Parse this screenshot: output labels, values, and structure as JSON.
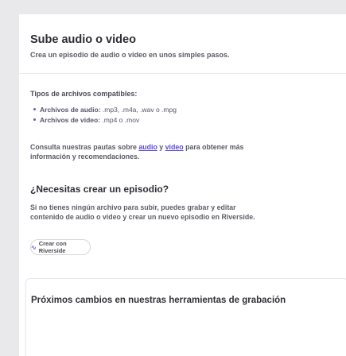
{
  "upload": {
    "title": "Sube audio o video",
    "subtitle": "Crea un episodio de audio o video en unos simples pasos.",
    "types_heading": "Tipos de archivos compatibles:",
    "types": [
      {
        "label": "Archivos de audio:",
        "formats": " .mp3, .m4a, .wav o .mpg"
      },
      {
        "label": "Archivos de video:",
        "formats": " .mp4 o .mov"
      }
    ],
    "guidelines": {
      "prefix": "Consulta nuestras pautas sobre ",
      "link_audio": "audio",
      "middle": " y ",
      "link_video": "video",
      "suffix": " para obtener más información y recomendaciones."
    }
  },
  "need_episode": {
    "heading": "¿Necesitas crear un episodio?",
    "body": "Si no tienes ningún archivo para subir, puedes grabar y editar contenido de audio o video y crear un nuevo episodio en Riverside.",
    "button_label": "Crear con Riverside",
    "button_icon": "riverside-wave-icon"
  },
  "card": {
    "title": "Próximos cambios en nuestras herramientas de grabación"
  }
}
